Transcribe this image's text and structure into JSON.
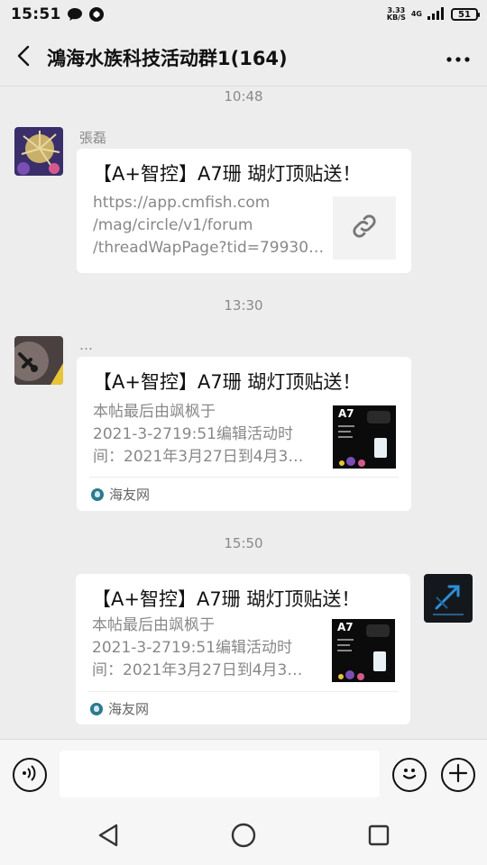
{
  "status_bar": {
    "time": "15:51",
    "net_speed_value": "3.33",
    "net_speed_unit": "KB/S",
    "network_type": "4G",
    "battery": "51"
  },
  "header": {
    "title": "鴻海水族科技活动群1(164)"
  },
  "messages": [
    {
      "timestamp": "10:48",
      "sender": "張磊",
      "card_title": "【A+智控】A7珊 瑚灯顶贴送！",
      "card_desc_lines": [
        "https://app.cmfish.com",
        "/mag/circle/v1/forum",
        "/threadWapPage?tid=79930…"
      ]
    },
    {
      "timestamp": "13:30",
      "sender": "…",
      "card_title": "【A+智控】A7珊 瑚灯顶贴送！",
      "card_desc_lines": [
        "本帖最后由飒枫于",
        "2021-3-2719:51编辑活动时",
        "间：2021年3月27日到4月3…"
      ],
      "thumb_label": "A7",
      "source": "海友网"
    },
    {
      "timestamp": "15:50",
      "card_title": "【A+智控】A7珊 瑚灯顶贴送！",
      "card_desc_lines": [
        "本帖最后由飒枫于",
        "2021-3-2719:51编辑活动时",
        "间：2021年3月27日到4月3…"
      ],
      "thumb_label": "A7",
      "source": "海友网"
    }
  ],
  "colors": {
    "background": "#ededed",
    "card": "#ffffff",
    "muted_text": "#8a8a8a",
    "source_icon": "#2b7a8e"
  },
  "icons": [
    "chat-bubble-icon",
    "shield-app-icon",
    "signal-icon",
    "back-chevron-icon",
    "more-dots-icon",
    "link-icon",
    "voice-icon",
    "emoji-icon",
    "plus-icon",
    "nav-back-icon",
    "nav-home-icon",
    "nav-recent-icon"
  ]
}
